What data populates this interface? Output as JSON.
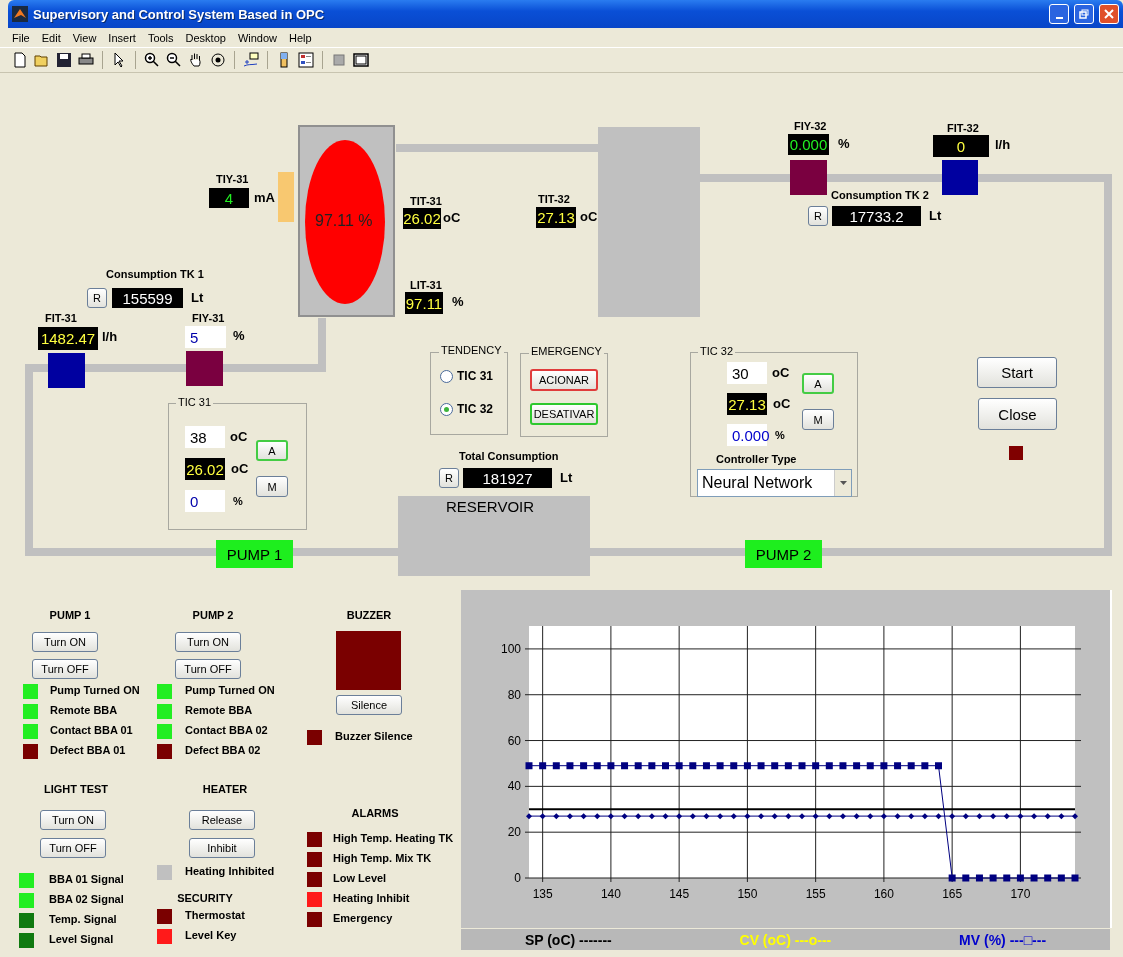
{
  "window": {
    "title": "Supervisory and Control System Based in OPC"
  },
  "menu": [
    "File",
    "Edit",
    "View",
    "Insert",
    "Tools",
    "Desktop",
    "Window",
    "Help"
  ],
  "process": {
    "tiy_31": {
      "tag": "TIY-31",
      "value": "4",
      "unit": "mA"
    },
    "tank_1": {
      "reading": "97.11 %"
    },
    "tit_31": {
      "tag": "TIT-31",
      "value": "26.02",
      "unit": "oC"
    },
    "lit_31": {
      "tag": "LIT-31",
      "value": "97.11",
      "unit": "%"
    },
    "tit_32": {
      "tag": "TIT-32",
      "value": "27.13",
      "unit": "oC"
    },
    "fiy_32": {
      "tag": "FIY-32",
      "value": "0.000",
      "unit": "%"
    },
    "fit_32": {
      "tag": "FIT-32",
      "value": "0",
      "unit": "l/h"
    },
    "consumption_tk2": {
      "title": "Consumption TK 2",
      "reset": "R",
      "value": "17733.2",
      "unit": "Lt"
    },
    "consumption_tk1": {
      "title": "Consumption TK 1",
      "reset": "R",
      "value": "155599",
      "unit": "Lt"
    },
    "fit_31": {
      "tag": "FIT-31",
      "value": "1482.47",
      "unit": "l/h"
    },
    "fiy_31": {
      "tag": "FIY-31",
      "value": "5",
      "unit": "%"
    },
    "tic_31": {
      "title": "TIC 31",
      "setpoint": "38",
      "setpoint_unit": "oC",
      "pv": "26.02",
      "pv_unit": "oC",
      "mv": "0",
      "mv_unit": "%",
      "auto": "A",
      "manual": "M"
    },
    "tendency": {
      "title": "TENDENCY",
      "options": [
        {
          "label": "TIC 31",
          "selected": false
        },
        {
          "label": "TIC 32",
          "selected": true
        }
      ]
    },
    "emergency": {
      "title": "EMERGENCY",
      "buttons": [
        {
          "label": "ACIONAR",
          "color": "#e03c3c"
        },
        {
          "label": "DESATIVAR",
          "color": "#2ec82e"
        }
      ]
    },
    "total_consumption": {
      "title": "Total Consumption",
      "reset": "R",
      "value": "181927",
      "unit": "Lt"
    },
    "reservoir": {
      "label": "RESERVOIR"
    },
    "pumps": [
      {
        "label": "PUMP 1"
      },
      {
        "label": "PUMP 2"
      }
    ],
    "tic_32": {
      "title": "TIC 32",
      "setpoint": "30",
      "setpoint_unit": "oC",
      "pv": "27.13",
      "pv_unit": "oC",
      "mv": "0.000",
      "mv_unit": "%",
      "auto": "A",
      "manual": "M",
      "controller_type_label": "Controller Type",
      "controller_type": "Neural Network"
    },
    "start": "Start",
    "close": "Close",
    "status_lamp": {
      "color": "#800000"
    }
  },
  "panels": {
    "pump_1": {
      "title": "PUMP 1",
      "buttons": [
        "Turn ON",
        "Turn OFF"
      ],
      "lamps": [
        {
          "label": "Pump Turned ON",
          "color": "#22ee22"
        },
        {
          "label": "Remote BBA",
          "color": "#22ee22"
        },
        {
          "label": "Contact BBA 01",
          "color": "#22ee22"
        },
        {
          "label": "Defect BBA 01",
          "color": "#7a0000"
        }
      ]
    },
    "pump_2": {
      "title": "PUMP 2",
      "buttons": [
        "Turn ON",
        "Turn OFF"
      ],
      "lamps": [
        {
          "label": "Pump Turned ON",
          "color": "#22ee22"
        },
        {
          "label": "Remote BBA",
          "color": "#22ee22"
        },
        {
          "label": "Contact BBA 02",
          "color": "#22ee22"
        },
        {
          "label": "Defect BBA 02",
          "color": "#7a0000"
        }
      ]
    },
    "buzzer": {
      "title": "BUZZER",
      "indicator": {
        "color": "#7a0000"
      },
      "button": "Silence",
      "lamps": [
        {
          "label": "Buzzer Silence",
          "color": "#7a0000"
        }
      ]
    },
    "light_test": {
      "title": "LIGHT TEST",
      "buttons": [
        "Turn ON",
        "Turn OFF"
      ],
      "lamps": [
        {
          "label": "BBA 01 Signal",
          "color": "#22ee22"
        },
        {
          "label": "BBA 02 Signal",
          "color": "#22ee22"
        },
        {
          "label": "Temp. Signal",
          "color": "#107a10"
        },
        {
          "label": "Level Signal",
          "color": "#107a10"
        }
      ]
    },
    "heater": {
      "title": "HEATER",
      "buttons": [
        "Release",
        "Inhibit"
      ],
      "lamps": [
        {
          "label": "Heating Inhibited",
          "color": "#c0c0c0"
        }
      ]
    },
    "security": {
      "title": "SECURITY",
      "lamps": [
        {
          "label": "Thermostat",
          "color": "#7a0000"
        },
        {
          "label": "Level Key",
          "color": "#ff1a1a"
        }
      ]
    },
    "alarms": {
      "title": "ALARMS",
      "lamps": [
        {
          "label": "High Temp. Heating TK",
          "color": "#7a0000"
        },
        {
          "label": "High Temp. Mix TK",
          "color": "#7a0000"
        },
        {
          "label": "Low Level",
          "color": "#7a0000"
        },
        {
          "label": "Heating Inhibit",
          "color": "#ff1a1a"
        },
        {
          "label": "Emergency",
          "color": "#7a0000"
        }
      ]
    }
  },
  "trend": {
    "chart_data": {
      "type": "line",
      "x": [
        134,
        135,
        136,
        137,
        138,
        139,
        140,
        141,
        142,
        143,
        144,
        145,
        146,
        147,
        148,
        149,
        150,
        151,
        152,
        153,
        154,
        155,
        156,
        157,
        158,
        159,
        160,
        161,
        162,
        163,
        164,
        165,
        166,
        167,
        168,
        169,
        170,
        171,
        172,
        173,
        174
      ],
      "xlim": [
        134,
        174
      ],
      "grid": true,
      "ylim": [
        0,
        110
      ],
      "xticks": [
        135,
        140,
        145,
        150,
        155,
        160,
        165,
        170
      ],
      "yticks": [
        0,
        20,
        40,
        60,
        80,
        100
      ],
      "series": [
        {
          "name": "SP (oC)",
          "color": "#000000",
          "values": [
            30,
            30,
            30,
            30,
            30,
            30,
            30,
            30,
            30,
            30,
            30,
            30,
            30,
            30,
            30,
            30,
            30,
            30,
            30,
            30,
            30,
            30,
            30,
            30,
            30,
            30,
            30,
            30,
            30,
            30,
            30,
            30,
            30,
            30,
            30,
            30,
            30,
            30,
            30,
            30,
            30
          ]
        },
        {
          "name": "CV (oC)",
          "color": "#000080",
          "marker": "diamond",
          "values": [
            27,
            27,
            27,
            27,
            27,
            27,
            27,
            27,
            27,
            27,
            27,
            27,
            27,
            27,
            27,
            27,
            27,
            27,
            27,
            27,
            27,
            27,
            27,
            27,
            27,
            27,
            27,
            27,
            27,
            27,
            27,
            27,
            27,
            27,
            27,
            27,
            27,
            27,
            27,
            27,
            27
          ]
        },
        {
          "name": "MV (%)",
          "color": "#000080",
          "marker": "square",
          "values": [
            49,
            49,
            49,
            49,
            49,
            49,
            49,
            49,
            49,
            49,
            49,
            49,
            49,
            49,
            49,
            49,
            49,
            49,
            49,
            49,
            49,
            49,
            49,
            49,
            49,
            49,
            49,
            49,
            49,
            49,
            49,
            0,
            0,
            0,
            0,
            0,
            0,
            0,
            0,
            0,
            0
          ]
        }
      ]
    },
    "legend": [
      {
        "symbol": "-------",
        "color": "#000000"
      },
      {
        "symbol": "---o---",
        "color": "#ffff00"
      },
      {
        "symbol": "---□---",
        "color": "#0000cc"
      }
    ]
  }
}
